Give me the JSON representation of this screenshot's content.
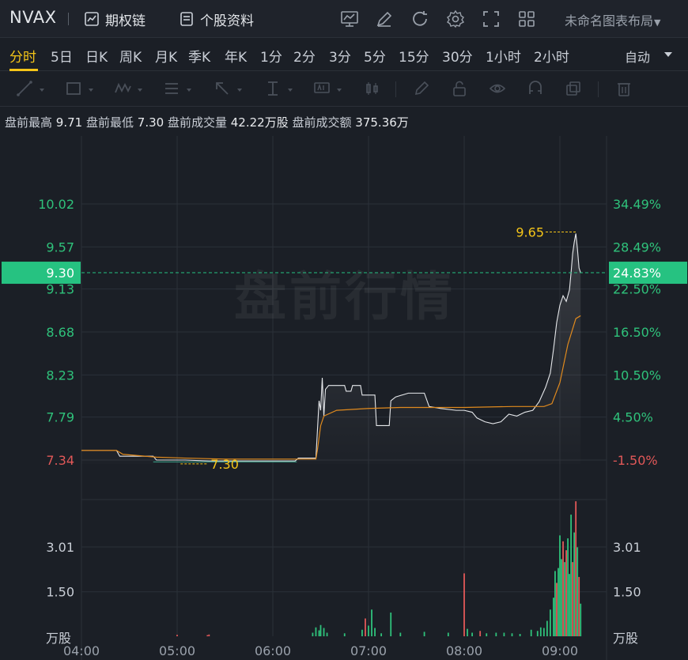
{
  "header": {
    "ticker": "NVAX",
    "options_chain": "期权链",
    "stock_profile": "个股资料",
    "layout_name": "未命名图表布局"
  },
  "periods": {
    "items": [
      "分时",
      "5日",
      "日K",
      "周K",
      "月K",
      "季K",
      "年K",
      "1分",
      "2分",
      "3分",
      "5分",
      "15分",
      "30分",
      "1小时",
      "2小时"
    ],
    "active": "分时",
    "auto_label": "自动"
  },
  "info": {
    "high_label": "盘前最高",
    "high": "9.71",
    "low_label": "盘前最低",
    "low": "7.30",
    "vol_label": "盘前成交量",
    "vol": "42.22万股",
    "amt_label": "盘前成交额",
    "amt": "375.36万"
  },
  "colors": {
    "up": "#2fc27b",
    "down": "#e25858",
    "highlight": "#26c281",
    "avg_line": "#e08a1e",
    "annotation": "#f5c518"
  },
  "chart_data": {
    "type": "line",
    "watermark": "盘前行情",
    "x_ticks": [
      "04:00",
      "05:00",
      "06:00",
      "07:00",
      "08:00",
      "09:00"
    ],
    "y_price_ticks": [
      {
        "value": 10.02,
        "label": "10.02",
        "pct": "34.49%"
      },
      {
        "value": 9.57,
        "label": "9.57",
        "pct": "28.49%"
      },
      {
        "value": 9.13,
        "label": "9.13",
        "pct": "22.50%"
      },
      {
        "value": 8.68,
        "label": "8.68",
        "pct": "16.50%"
      },
      {
        "value": 8.23,
        "label": "8.23",
        "pct": "10.50%"
      },
      {
        "value": 7.79,
        "label": "7.79",
        "pct": "4.50%"
      },
      {
        "value": 7.34,
        "label": "7.34",
        "pct": "-1.50%"
      }
    ],
    "current": {
      "price": "9.30",
      "pct": "24.83%",
      "value": 9.3
    },
    "high_annotation": {
      "label": "9.65",
      "value": 9.71,
      "time": "09:10"
    },
    "low_annotation": {
      "label": "7.30",
      "value": 7.3,
      "time": "05:17"
    },
    "volume_ticks": [
      {
        "value": 3.01,
        "label": "3.01"
      },
      {
        "value": 1.5,
        "label": "1.50"
      }
    ],
    "volume_unit": "万股",
    "price_series": [
      [
        "04:00",
        7.44
      ],
      [
        "04:22",
        7.44
      ],
      [
        "04:24",
        7.38
      ],
      [
        "04:45",
        7.38
      ],
      [
        "04:47",
        7.34
      ],
      [
        "05:05",
        7.34
      ],
      [
        "05:20",
        7.33
      ],
      [
        "05:45",
        7.33
      ],
      [
        "06:00",
        7.33
      ],
      [
        "06:14",
        7.33
      ],
      [
        "06:16",
        7.36
      ],
      [
        "06:27",
        7.36
      ],
      [
        "06:28",
        7.66
      ],
      [
        "06:29",
        7.96
      ],
      [
        "06:30",
        7.86
      ],
      [
        "06:31",
        8.2
      ],
      [
        "06:32",
        7.8
      ],
      [
        "06:33",
        8.08
      ],
      [
        "06:35",
        8.12
      ],
      [
        "06:45",
        8.12
      ],
      [
        "06:46",
        8.06
      ],
      [
        "06:49",
        8.06
      ],
      [
        "06:50",
        8.12
      ],
      [
        "06:55",
        8.12
      ],
      [
        "06:56",
        8.02
      ],
      [
        "07:04",
        8.02
      ],
      [
        "07:05",
        7.7
      ],
      [
        "07:13",
        7.7
      ],
      [
        "07:14",
        7.96
      ],
      [
        "07:17",
        8.0
      ],
      [
        "07:25",
        8.04
      ],
      [
        "07:35",
        8.04
      ],
      [
        "07:38",
        7.9
      ],
      [
        "07:45",
        7.88
      ],
      [
        "07:55",
        7.86
      ],
      [
        "08:00",
        7.86
      ],
      [
        "08:05",
        7.84
      ],
      [
        "08:08",
        7.78
      ],
      [
        "08:13",
        7.74
      ],
      [
        "08:18",
        7.72
      ],
      [
        "08:23",
        7.74
      ],
      [
        "08:28",
        7.82
      ],
      [
        "08:33",
        7.8
      ],
      [
        "08:38",
        7.84
      ],
      [
        "08:43",
        7.86
      ],
      [
        "08:47",
        7.95
      ],
      [
        "08:51",
        8.1
      ],
      [
        "08:54",
        8.25
      ],
      [
        "08:56",
        8.5
      ],
      [
        "08:58",
        8.78
      ],
      [
        "09:00",
        8.96
      ],
      [
        "09:02",
        9.06
      ],
      [
        "09:04",
        9.0
      ],
      [
        "09:06",
        9.12
      ],
      [
        "09:07",
        9.3
      ],
      [
        "09:08",
        9.5
      ],
      [
        "09:09",
        9.62
      ],
      [
        "09:10",
        9.71
      ],
      [
        "09:11",
        9.55
      ],
      [
        "09:12",
        9.35
      ],
      [
        "09:13",
        9.3
      ]
    ],
    "avg_series": [
      [
        "04:00",
        7.44
      ],
      [
        "04:22",
        7.44
      ],
      [
        "04:26",
        7.4
      ],
      [
        "04:47",
        7.37
      ],
      [
        "05:05",
        7.36
      ],
      [
        "05:30",
        7.35
      ],
      [
        "06:00",
        7.35
      ],
      [
        "06:27",
        7.35
      ],
      [
        "06:28",
        7.45
      ],
      [
        "06:30",
        7.7
      ],
      [
        "06:32",
        7.8
      ],
      [
        "06:40",
        7.86
      ],
      [
        "07:00",
        7.88
      ],
      [
        "07:20",
        7.89
      ],
      [
        "08:00",
        7.89
      ],
      [
        "08:30",
        7.9
      ],
      [
        "08:50",
        7.9
      ],
      [
        "08:55",
        7.93
      ],
      [
        "09:00",
        8.15
      ],
      [
        "09:05",
        8.55
      ],
      [
        "09:10",
        8.82
      ],
      [
        "09:13",
        8.85
      ]
    ],
    "volume_series": [
      [
        "05:00",
        0.05
      ],
      [
        "05:19",
        0.04
      ],
      [
        "05:20",
        0.06
      ],
      [
        "06:25",
        0.12
      ],
      [
        "06:27",
        0.3
      ],
      [
        "06:29",
        0.2
      ],
      [
        "06:30",
        0.38
      ],
      [
        "06:32",
        0.28
      ],
      [
        "06:34",
        0.12
      ],
      [
        "06:45",
        0.1
      ],
      [
        "06:56",
        0.22
      ],
      [
        "06:58",
        0.6
      ],
      [
        "07:00",
        0.36
      ],
      [
        "07:02",
        0.9
      ],
      [
        "07:04",
        0.28
      ],
      [
        "07:08",
        0.1
      ],
      [
        "07:14",
        0.8
      ],
      [
        "07:20",
        0.12
      ],
      [
        "07:35",
        0.15
      ],
      [
        "07:50",
        0.12
      ],
      [
        "08:00",
        2.12
      ],
      [
        "08:02",
        0.25
      ],
      [
        "08:05",
        0.12
      ],
      [
        "08:10",
        0.18
      ],
      [
        "08:14",
        0.1
      ],
      [
        "08:20",
        0.12
      ],
      [
        "08:25",
        0.12
      ],
      [
        "08:30",
        0.1
      ],
      [
        "08:35",
        0.08
      ],
      [
        "08:42",
        0.22
      ],
      [
        "08:46",
        0.18
      ],
      [
        "08:48",
        0.3
      ],
      [
        "08:50",
        0.28
      ],
      [
        "08:52",
        0.52
      ],
      [
        "08:54",
        0.9
      ],
      [
        "08:56",
        1.3
      ],
      [
        "08:57",
        2.2
      ],
      [
        "08:58",
        1.8
      ],
      [
        "08:59",
        2.3
      ],
      [
        "09:00",
        3.4
      ],
      [
        "09:01",
        2.6
      ],
      [
        "09:02",
        3.2
      ],
      [
        "09:03",
        2.5
      ],
      [
        "09:04",
        2.9
      ],
      [
        "09:05",
        3.3
      ],
      [
        "09:06",
        2.1
      ],
      [
        "09:07",
        4.1
      ],
      [
        "09:08",
        2.5
      ],
      [
        "09:09",
        3.5
      ],
      [
        "09:10",
        4.55
      ],
      [
        "09:11",
        3.0
      ],
      [
        "09:12",
        2.0
      ],
      [
        "09:13",
        1.1
      ]
    ],
    "volume_colors": [
      "down",
      "down",
      "down",
      "up",
      "up",
      "up",
      "up",
      "up",
      "up",
      "up",
      "up",
      "down",
      "up",
      "up",
      "up",
      "up",
      "up",
      "up",
      "up",
      "up",
      "down",
      "up",
      "up",
      "down",
      "up",
      "up",
      "up",
      "up",
      "up",
      "up",
      "up",
      "up",
      "up",
      "up",
      "up",
      "up",
      "up",
      "down",
      "up",
      "up",
      "up",
      "down",
      "up",
      "down",
      "up",
      "up",
      "up",
      "down",
      "up",
      "down",
      "up",
      "down",
      "up"
    ]
  }
}
